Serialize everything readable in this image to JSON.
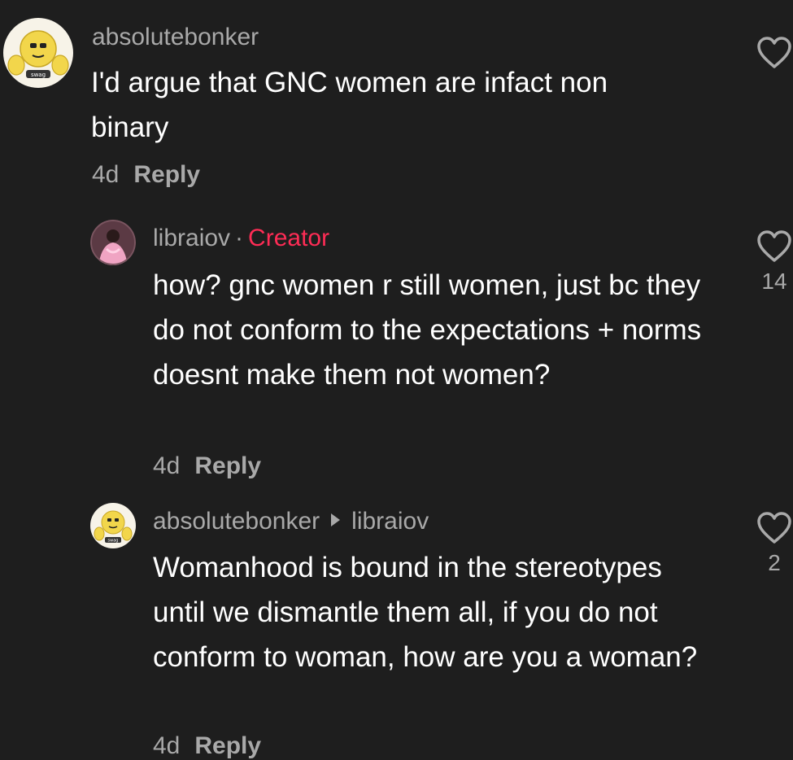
{
  "comments": [
    {
      "username": "absolutebonker",
      "text": "I'd argue that GNC women are infact non binary",
      "age": "4d",
      "reply_label": "Reply",
      "like_count": ""
    },
    {
      "username": "libraiov",
      "separator": "·",
      "badge": "Creator",
      "text": "how? gnc women r still women, just bc they do not conform to the expectations + norms doesnt make them not women?",
      "age": "4d",
      "reply_label": "Reply",
      "like_count": "14"
    },
    {
      "username": "absolutebonker",
      "reply_to": "libraiov",
      "text": "Womanhood is bound in the stereotypes until we dismantle them all, if you do not conform to woman, how are you a woman?",
      "age": "4d",
      "reply_label": "Reply",
      "like_count": "2"
    }
  ],
  "avatar_labels": {
    "swag": "swag"
  },
  "colors": {
    "background": "#1e1e1e",
    "text": "#ffffff",
    "muted": "#a9a9a9",
    "creator": "#fe2c55",
    "avatar_yellow": "#f2d64b"
  },
  "icons": {
    "like": "heart-outline-icon",
    "reply_arrow": "play-triangle-icon"
  }
}
